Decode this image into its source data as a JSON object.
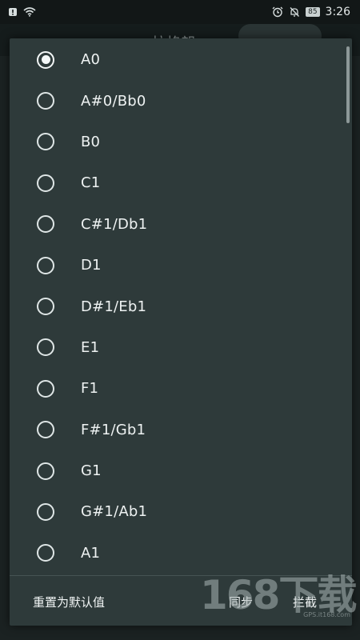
{
  "status_bar": {
    "battery": "85",
    "time": "3:26"
  },
  "background": {
    "title": "拉格朗"
  },
  "dialog": {
    "options": [
      {
        "label": "A0",
        "selected": true
      },
      {
        "label": "A#0/Bb0",
        "selected": false
      },
      {
        "label": "B0",
        "selected": false
      },
      {
        "label": "C1",
        "selected": false
      },
      {
        "label": "C#1/Db1",
        "selected": false
      },
      {
        "label": "D1",
        "selected": false
      },
      {
        "label": "D#1/Eb1",
        "selected": false
      },
      {
        "label": "E1",
        "selected": false
      },
      {
        "label": "F1",
        "selected": false
      },
      {
        "label": "F#1/Gb1",
        "selected": false
      },
      {
        "label": "G1",
        "selected": false
      },
      {
        "label": "G#1/Ab1",
        "selected": false
      },
      {
        "label": "A1",
        "selected": false
      }
    ],
    "buttons": {
      "reset": "重置为默认值",
      "sync": "同步",
      "intercept": "拦截"
    }
  },
  "watermark": {
    "main": "168下载",
    "sub": "GPS.it168.com"
  },
  "colors": {
    "dialog_bg": "#2e3a3a",
    "page_bg": "#1b2222",
    "text": "#eef2f2"
  }
}
